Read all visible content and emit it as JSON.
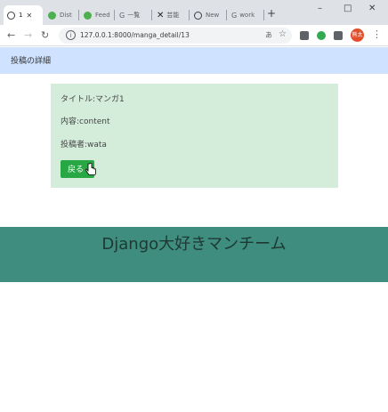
{
  "browser": {
    "tabs": [
      {
        "label": "1",
        "icon": "page-icon"
      },
      {
        "label": "Dist",
        "icon": "green-site-icon"
      },
      {
        "label": "Feed",
        "icon": "green-site-icon"
      },
      {
        "label": "一覧",
        "icon": "search-icon"
      },
      {
        "label": "芸能",
        "icon": "x-icon"
      },
      {
        "label": "New",
        "icon": "page-icon"
      },
      {
        "label": "work",
        "icon": "search-icon"
      }
    ],
    "new_tab": "+",
    "controls": {
      "minimize": "–",
      "maximize": "□",
      "close": "✕"
    },
    "url": "127.0.0.1:8000/manga_detail/13",
    "avatar_text": "熊太"
  },
  "navbar": {
    "brand": "投稿の詳細"
  },
  "detail": {
    "title_line": "タイトル:マンガ1",
    "content_line": "内容:content",
    "author_line": "投稿者:wata",
    "back_label": "戻る"
  },
  "footer": {
    "text": "Django大好きマンチーム"
  },
  "colors": {
    "navbar_bg": "#cfe2ff",
    "card_bg": "#d4edda",
    "button_bg": "#28a745",
    "footer_bg": "#3e8d7e"
  }
}
